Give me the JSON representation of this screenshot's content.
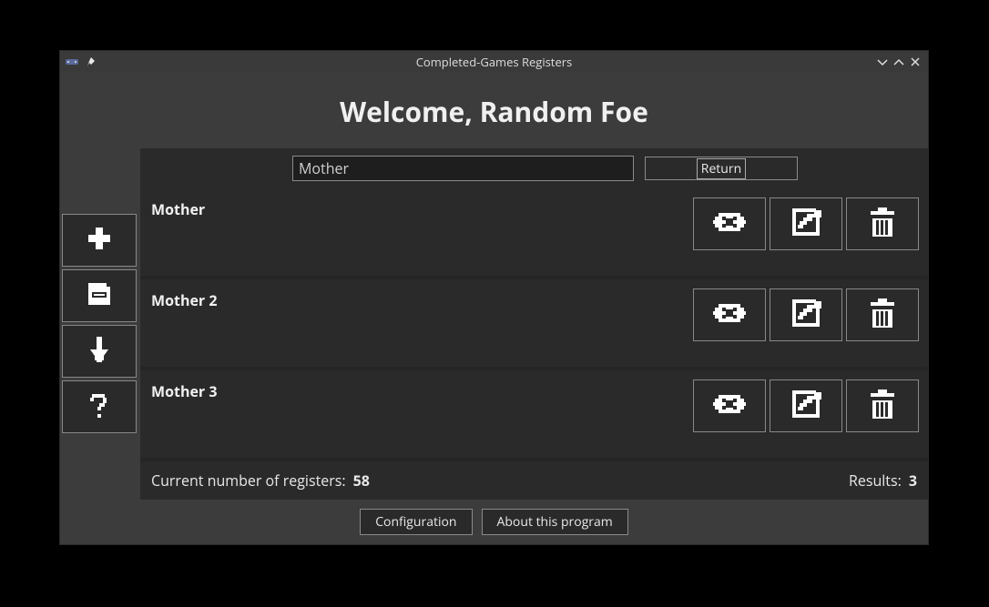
{
  "window": {
    "title": "Completed-Games Registers"
  },
  "header": {
    "welcome": "Welcome, Random Foe"
  },
  "search": {
    "value": "Mother",
    "return_label": "Return"
  },
  "sidebar": {
    "items": [
      {
        "icon": "plus-icon"
      },
      {
        "icon": "save-icon"
      },
      {
        "icon": "download-icon"
      },
      {
        "icon": "help-icon"
      }
    ]
  },
  "rows": [
    {
      "title": "Mother"
    },
    {
      "title": "Mother 2"
    },
    {
      "title": "Mother 3"
    }
  ],
  "row_actions": {
    "view": "view-icon",
    "edit": "edit-icon",
    "delete": "trash-icon"
  },
  "status": {
    "count_label": "Current number of registers:",
    "count_value": "58",
    "results_label": "Results:",
    "results_value": "3"
  },
  "footer": {
    "config": "Configuration",
    "about": "About this program"
  }
}
